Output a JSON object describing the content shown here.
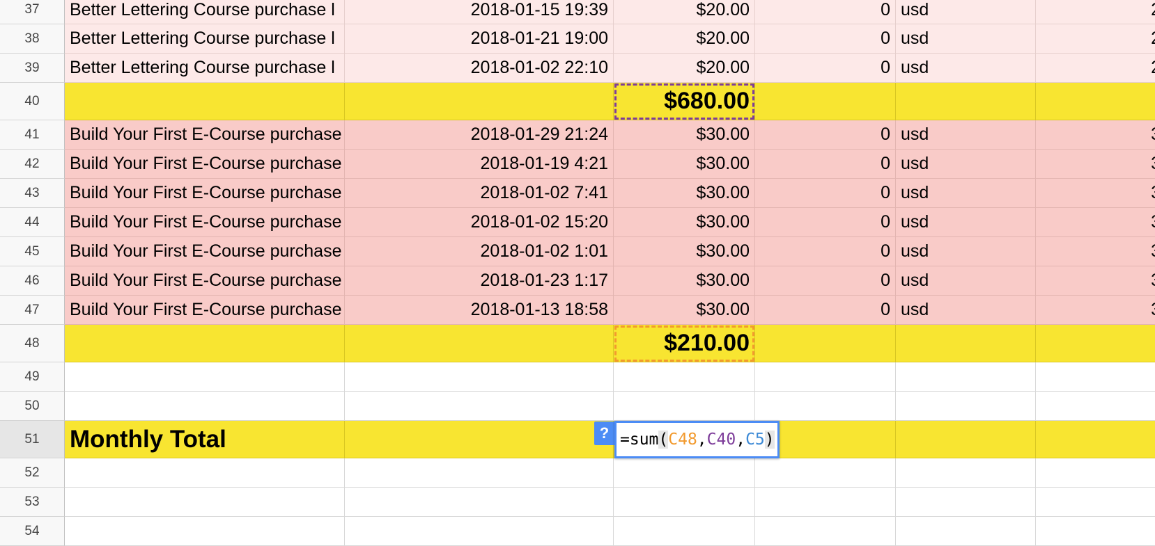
{
  "colors": {
    "light_pink_row": "#fde9e8",
    "pink_row": "#f9cbc8",
    "yellow_row": "#f8e531",
    "ref_orange": "#f29a2e",
    "ref_purple": "#7e3d9a",
    "ref_blue": "#3d8ad6",
    "editor_border": "#4c8cf5"
  },
  "rows": [
    {
      "num": "37",
      "product": "Better Lettering Course purchase l",
      "date": "2018-01-15 19:39",
      "amount": "$20.00",
      "fee": "0",
      "currency": "usd",
      "edge": "2"
    },
    {
      "num": "38",
      "product": "Better Lettering Course purchase l",
      "date": "2018-01-21 19:00",
      "amount": "$20.00",
      "fee": "0",
      "currency": "usd",
      "edge": "2"
    },
    {
      "num": "39",
      "product": "Better Lettering Course purchase l",
      "date": "2018-01-02 22:10",
      "amount": "$20.00",
      "fee": "0",
      "currency": "usd",
      "edge": "2"
    },
    {
      "num": "40",
      "subtotal": "$680.00"
    },
    {
      "num": "41",
      "product": "Build Your First E-Course purchase",
      "date": "2018-01-29 21:24",
      "amount": "$30.00",
      "fee": "0",
      "currency": "usd",
      "edge": "3"
    },
    {
      "num": "42",
      "product": "Build Your First E-Course purchase",
      "date": "2018-01-19 4:21",
      "amount": "$30.00",
      "fee": "0",
      "currency": "usd",
      "edge": "3"
    },
    {
      "num": "43",
      "product": "Build Your First E-Course purchase",
      "date": "2018-01-02 7:41",
      "amount": "$30.00",
      "fee": "0",
      "currency": "usd",
      "edge": "3"
    },
    {
      "num": "44",
      "product": "Build Your First E-Course purchase",
      "date": "2018-01-02 15:20",
      "amount": "$30.00",
      "fee": "0",
      "currency": "usd",
      "edge": "3"
    },
    {
      "num": "45",
      "product": "Build Your First E-Course purchase",
      "date": "2018-01-02 1:01",
      "amount": "$30.00",
      "fee": "0",
      "currency": "usd",
      "edge": "3"
    },
    {
      "num": "46",
      "product": "Build Your First E-Course purchase",
      "date": "2018-01-23 1:17",
      "amount": "$30.00",
      "fee": "0",
      "currency": "usd",
      "edge": "3"
    },
    {
      "num": "47",
      "product": "Build Your First E-Course purchase",
      "date": "2018-01-13 18:58",
      "amount": "$30.00",
      "fee": "0",
      "currency": "usd",
      "edge": "3"
    },
    {
      "num": "48",
      "subtotal": "$210.00"
    },
    {
      "num": "49"
    },
    {
      "num": "50"
    },
    {
      "num": "51",
      "label": "Monthly Total"
    },
    {
      "num": "52"
    },
    {
      "num": "53"
    },
    {
      "num": "54"
    }
  ],
  "formula_editor": {
    "help_icon": "question-mark-icon",
    "help_label": "?",
    "prefix": "=sum",
    "open_paren": "(",
    "ref1": "C48",
    "sep1": ",",
    "ref2": "C40",
    "sep2": ",",
    "ref3": "C5",
    "close_paren": ")"
  }
}
